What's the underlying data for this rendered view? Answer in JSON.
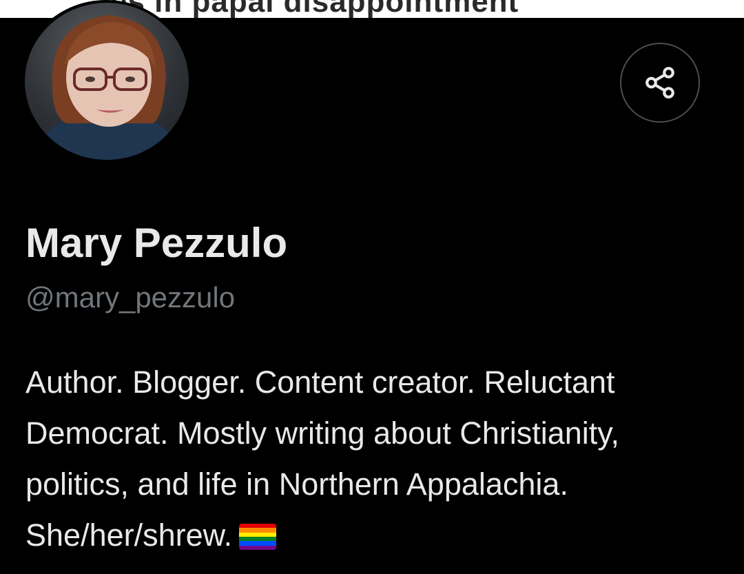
{
  "banner": {
    "text": "es in papal disappointment\""
  },
  "profile": {
    "display_name": "Mary Pezzulo",
    "handle": "@mary_pezzulo",
    "bio_lines": [
      "Author. Blogger. Content creator. Reluctant",
      "Democrat. Mostly writing about Christianity,",
      "politics, and life in Northern Appalachia.",
      "She/her/shrew."
    ],
    "bio_emoji": "rainbow-flag-icon"
  },
  "actions": {
    "share_icon": "share-icon"
  },
  "colors": {
    "background": "#000000",
    "primary_text": "#e7e9ea",
    "secondary_text": "#71767b",
    "button_border": "#4a4f54"
  }
}
